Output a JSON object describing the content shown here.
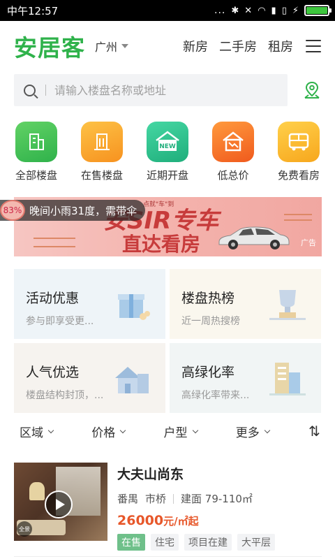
{
  "status_bar": {
    "time": "中午12:57",
    "dots": "...",
    "battery_level": 1.0
  },
  "header": {
    "logo": "安居客",
    "city": "广州",
    "nav": [
      "新房",
      "二手房",
      "租房"
    ]
  },
  "search": {
    "placeholder": "请输入楼盘名称或地址"
  },
  "categories": [
    {
      "label": "全部楼盘",
      "icon": "building-icon",
      "color": "#3fbd4a"
    },
    {
      "label": "在售楼盘",
      "icon": "sale-building-icon",
      "color": "#f7a21f"
    },
    {
      "label": "近期开盘",
      "icon": "new-house-icon",
      "color": "#2bbf8c"
    },
    {
      "label": "低总价",
      "icon": "low-price-house-icon",
      "color": "#f26a23"
    },
    {
      "label": "免费看房",
      "icon": "bus-icon",
      "color": "#f7ad1d"
    }
  ],
  "banner": {
    "line1": "安SIR专车",
    "line2": "直达看房",
    "small": "点就\"车\"到",
    "ad": "广告"
  },
  "weather": {
    "percent": "83%",
    "text": "晚间小雨31度，需带伞"
  },
  "cards": [
    {
      "title": "活动优惠",
      "subtitle": "参与即享受更...",
      "icon": "gift-icon"
    },
    {
      "title": "楼盘热榜",
      "subtitle": "近一周热搜榜",
      "icon": "trophy-icon"
    },
    {
      "title": "人气优选",
      "subtitle": "楼盘结构封顶，...",
      "icon": "house-icon"
    },
    {
      "title": "高绿化率",
      "subtitle": "高绿化率带来...",
      "icon": "tower-icon"
    }
  ],
  "filters": [
    {
      "label": "区域"
    },
    {
      "label": "价格"
    },
    {
      "label": "户型"
    },
    {
      "label": "更多"
    }
  ],
  "listing": {
    "name": "大夫山尚东",
    "district": "番禺",
    "area": "市桥",
    "size": "建面 79-110㎡",
    "price": "26000",
    "price_unit": "元/㎡起",
    "pano": "全景",
    "tags": [
      "在售",
      "住宅",
      "项目在建",
      "大平层"
    ]
  },
  "colors": {
    "brand": "#2fb24b",
    "price": "#e7572a"
  }
}
